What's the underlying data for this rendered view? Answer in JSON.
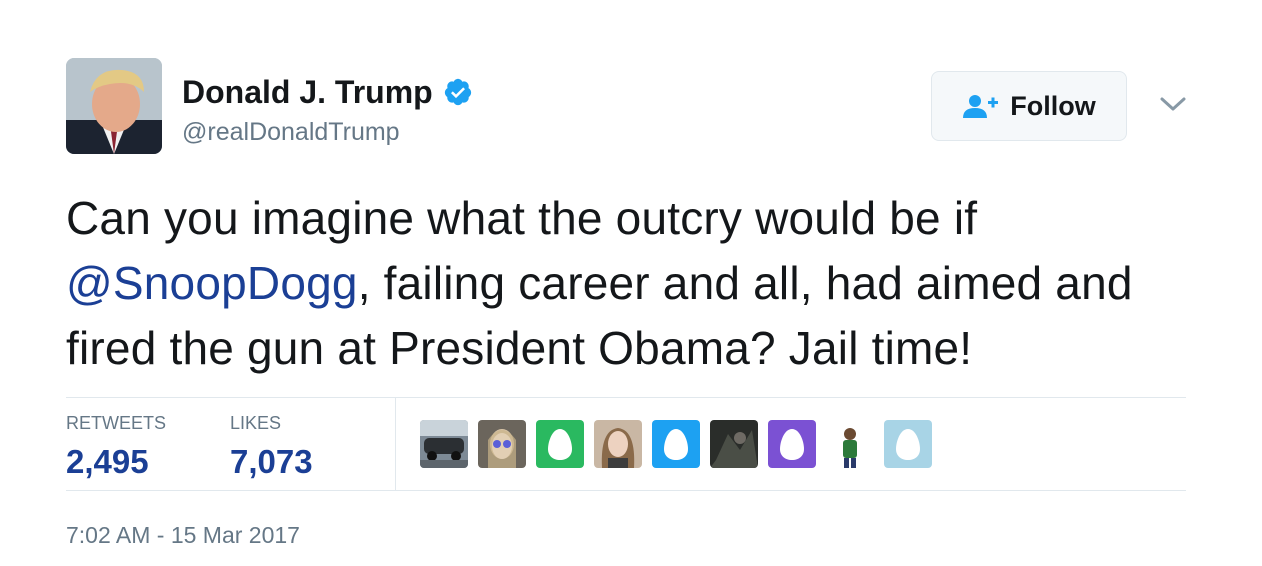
{
  "user": {
    "name": "Donald J. Trump",
    "handle": "@realDonaldTrump",
    "verified": true,
    "avatar_icon": "profile-photo-icon"
  },
  "follow_button": {
    "label": "Follow",
    "icon": "follow-person-plus-icon"
  },
  "menu_caret": {
    "icon": "chevron-down-icon"
  },
  "tweet": {
    "text_before": "Can you imagine what the outcry would be if ",
    "mention": "@SnoopDogg",
    "text_after": ", failing career and all, had aimed and fired the gun at President Obama? Jail time!"
  },
  "stats": {
    "retweets_label": "RETWEETS",
    "retweets_value": "2,495",
    "likes_label": "LIKES",
    "likes_value": "7,073"
  },
  "likers": [
    {
      "kind": "photo",
      "icon": "car-photo-icon"
    },
    {
      "kind": "photo",
      "icon": "person-sunglasses-photo-icon"
    },
    {
      "kind": "egg",
      "icon": "egg-icon",
      "color": "#2ab960"
    },
    {
      "kind": "photo",
      "icon": "person-photo-icon"
    },
    {
      "kind": "egg",
      "icon": "egg-icon",
      "color": "#1da1f2"
    },
    {
      "kind": "photo",
      "icon": "dark-photo-icon"
    },
    {
      "kind": "egg",
      "icon": "egg-icon",
      "color": "#7b51d3"
    },
    {
      "kind": "photo",
      "icon": "person-standing-photo-icon"
    },
    {
      "kind": "egg",
      "icon": "egg-icon",
      "color": "#a8d4e6"
    }
  ],
  "timestamp": "7:02 AM - 15 Mar 2017",
  "colors": {
    "accent": "#1da1f2",
    "link": "#1b3f95",
    "secondary_text": "#657786",
    "divider": "#e1e8ed"
  }
}
